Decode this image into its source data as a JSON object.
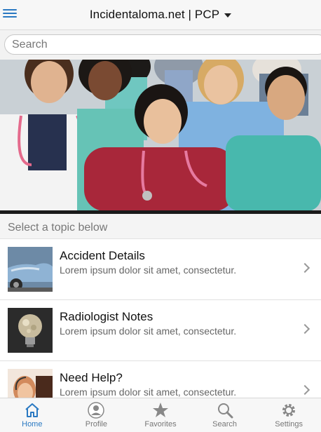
{
  "header": {
    "title": "Incidentaloma.net | PCP"
  },
  "search": {
    "placeholder": "Search"
  },
  "section": {
    "title": "Select a topic below"
  },
  "topics": [
    {
      "title": "Accident Details",
      "desc": "Lorem ipsum dolor sit amet, consectetur.",
      "icon": "car-thumbnail"
    },
    {
      "title": "Radiologist Notes",
      "desc": "Lorem ipsum dolor sit amet, consectetur.",
      "icon": "lightbulb-thumbnail"
    },
    {
      "title": "Need Help?",
      "desc": "Lorem ipsum dolor sit amet, consectetur.",
      "icon": "support-agent-thumbnail"
    }
  ],
  "tabs": [
    {
      "label": "Home",
      "icon": "home-icon",
      "active": true
    },
    {
      "label": "Profile",
      "icon": "profile-icon",
      "active": false
    },
    {
      "label": "Favorites",
      "icon": "star-icon",
      "active": false
    },
    {
      "label": "Search",
      "icon": "search-icon",
      "active": false
    },
    {
      "label": "Settings",
      "icon": "gear-icon",
      "active": false
    }
  ],
  "colors": {
    "accent": "#2a79c2",
    "inactive": "#777777"
  }
}
